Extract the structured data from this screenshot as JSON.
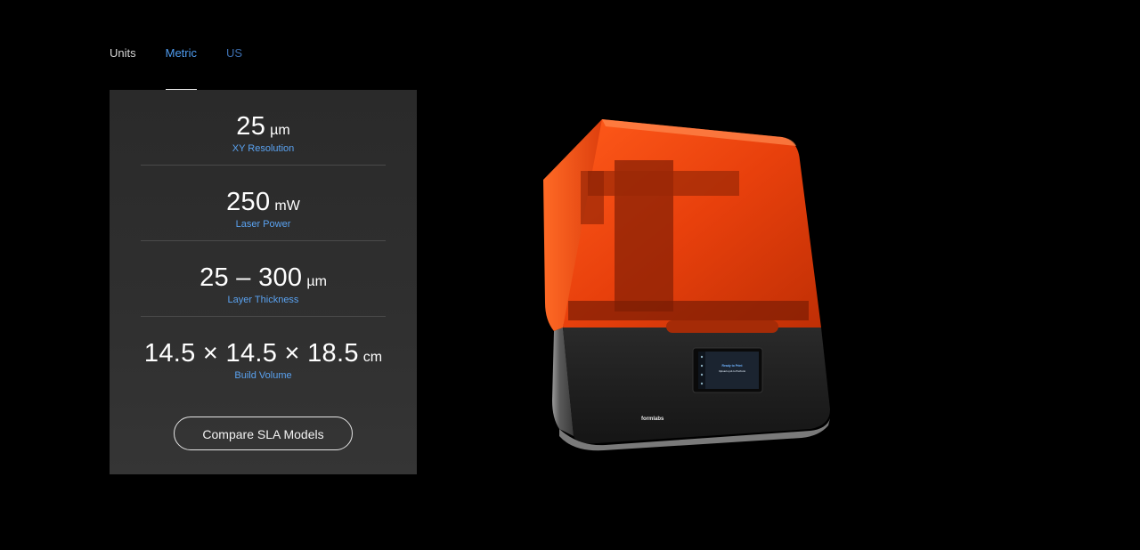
{
  "units": {
    "label": "Units",
    "tabs": [
      {
        "label": "Metric",
        "active": true
      },
      {
        "label": "US",
        "active": false
      }
    ]
  },
  "specs": [
    {
      "value": "25",
      "unit": "µm",
      "label": "XY Resolution"
    },
    {
      "value": "250",
      "unit": "mW",
      "label": "Laser Power"
    },
    {
      "value": "25 – 300",
      "unit": "µm",
      "label": "Layer Thickness"
    },
    {
      "value": "14.5 × 14.5 × 18.5",
      "unit": "cm",
      "label": "Build Volume"
    }
  ],
  "compare_button": "Compare SLA Models",
  "printer": {
    "brand": "formlabs",
    "screen_title": "Ready to Print",
    "screen_subtitle": "Upload a job to PreForm"
  },
  "colors": {
    "accent": "#4f9cf0",
    "inactive_tab": "#3d6fb0",
    "card_bg": "#2e2e2e",
    "cover_orange": "#e8400c"
  }
}
